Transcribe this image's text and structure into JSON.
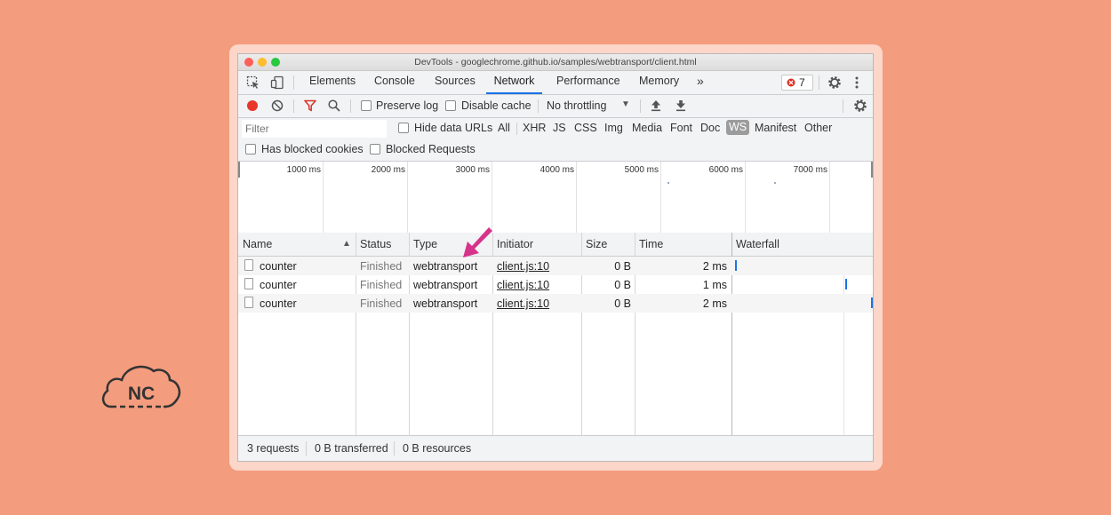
{
  "window": {
    "title": "DevTools - googlechrome.github.io/samples/webtransport/client.html"
  },
  "tabs": [
    "Elements",
    "Console",
    "Sources",
    "Network",
    "Performance",
    "Memory"
  ],
  "more_tabs": "»",
  "error_count": "7",
  "toolbar": {
    "preserve_log": "Preserve log",
    "disable_cache": "Disable cache",
    "throttling": "No throttling"
  },
  "filter": {
    "placeholder": "Filter",
    "hide_data_urls": "Hide data URLs",
    "types": [
      "All",
      "XHR",
      "JS",
      "CSS",
      "Img",
      "Media",
      "Font",
      "Doc",
      "WS",
      "Manifest",
      "Other"
    ],
    "active_type": "WS",
    "has_blocked_cookies": "Has blocked cookies",
    "blocked_requests": "Blocked Requests"
  },
  "overview_ticks": [
    "1000 ms",
    "2000 ms",
    "3000 ms",
    "4000 ms",
    "5000 ms",
    "6000 ms",
    "7000 ms"
  ],
  "columns": [
    "Name",
    "Status",
    "Type",
    "Initiator",
    "Size",
    "Time",
    "Waterfall"
  ],
  "sort_indicator": "▲",
  "rows": [
    {
      "name": "counter",
      "status": "Finished",
      "type": "webtransport",
      "initiator": "client.js:10",
      "size": "0 B",
      "time": "2 ms"
    },
    {
      "name": "counter",
      "status": "Finished",
      "type": "webtransport",
      "initiator": "client.js:10",
      "size": "0 B",
      "time": "1 ms"
    },
    {
      "name": "counter",
      "status": "Finished",
      "type": "webtransport",
      "initiator": "client.js:10",
      "size": "0 B",
      "time": "2 ms"
    }
  ],
  "footer": {
    "requests": "3 requests",
    "transferred": "0 B transferred",
    "resources": "0 B resources"
  },
  "logo": {
    "text": "NC"
  },
  "colors": {
    "background": "#f39c7e",
    "annotation_arrow": "#d6338a",
    "record": "#e8362b",
    "accent": "#1a73e8"
  },
  "icons": [
    "inspect-icon",
    "device-toggle-icon",
    "record-icon",
    "clear-icon",
    "filter-icon",
    "search-icon",
    "upload-icon",
    "download-icon",
    "settings-icon",
    "kebab-menu-icon",
    "error-icon",
    "document-icon"
  ]
}
